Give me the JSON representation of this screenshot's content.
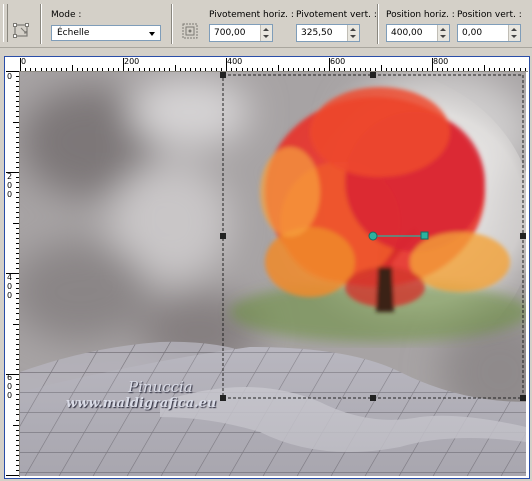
{
  "toolbar": {
    "mode": {
      "label": "Mode :",
      "value": "Échelle"
    },
    "pivot_h": {
      "label": "Pivotement horiz. :",
      "value": "700,00"
    },
    "pivot_v": {
      "label": "Pivotement vert. :",
      "value": "325,50"
    },
    "pos_h": {
      "label": "Position horiz. :",
      "value": "400,00"
    },
    "pos_v": {
      "label": "Position vert. :",
      "value": "0,00"
    }
  },
  "ruler": {
    "top_numbers": [
      "0",
      "200",
      "400",
      "600",
      "800"
    ],
    "left_numbers": [
      [
        "0"
      ],
      [
        "2",
        "0",
        "0"
      ],
      [
        "4",
        "0",
        "0"
      ],
      [
        "6",
        "0",
        "0"
      ]
    ]
  },
  "watermark": {
    "line1": "Pinuccia",
    "line2": "www.maldigrafica.eu"
  },
  "colors": {
    "frame_border": "#2a4da8",
    "selection_handle": "#222222",
    "pivot_handle": "#2bb3a0",
    "fog": "#9d999a",
    "tree_red": "#e8302a",
    "tree_orange": "#f08a2a"
  },
  "icons": {
    "deform_tool": "transform-tool-icon",
    "pivot": "pivot-icon"
  }
}
